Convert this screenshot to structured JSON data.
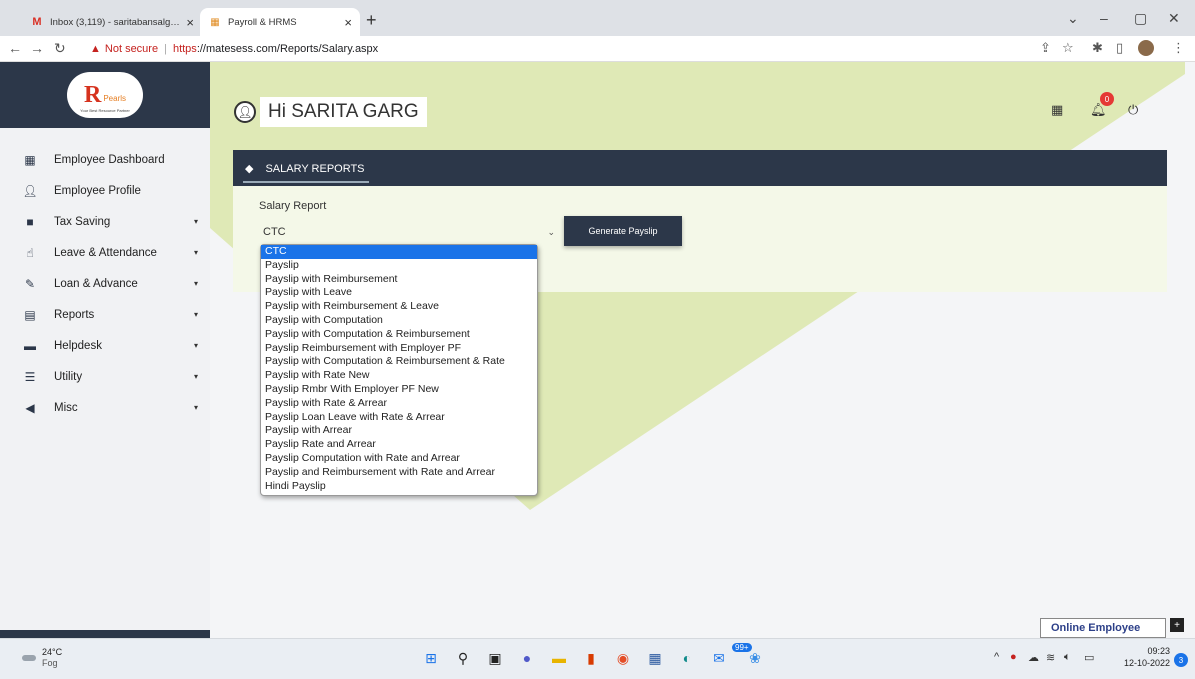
{
  "browser": {
    "tabs": [
      {
        "title": "Inbox (3,119) - saritabansalgarg. ",
        "favicon": "gmail-icon"
      },
      {
        "title": "Payroll & HRMS",
        "favicon": "hrms-icon"
      }
    ],
    "new_tab": "+",
    "not_secure": "Not secure",
    "url_scheme": "https",
    "url_rest": "://matesess.com/Reports/Salary.aspx"
  },
  "app": {
    "logo": {
      "letter": "R",
      "word": "Pearls",
      "tag": "Your Best Resource Partner"
    },
    "greeting": "Hi SARITA GARG",
    "notification_count": "0",
    "sidebar": [
      {
        "label": "Employee Dashboard",
        "icon": "dashboard-icon",
        "caret": ""
      },
      {
        "label": "Employee Profile",
        "icon": "user-icon",
        "caret": ""
      },
      {
        "label": "Tax Saving",
        "icon": "book-icon",
        "caret": "▾"
      },
      {
        "label": "Leave & Attendance",
        "icon": "thumbs-up-icon",
        "caret": "▾"
      },
      {
        "label": "Loan & Advance",
        "icon": "edit-icon",
        "caret": "▾"
      },
      {
        "label": "Reports",
        "icon": "report-icon",
        "caret": "▾"
      },
      {
        "label": "Helpdesk",
        "icon": "laptop-icon",
        "caret": "▾"
      },
      {
        "label": "Utility",
        "icon": "list-icon",
        "caret": "▾"
      },
      {
        "label": "Misc",
        "icon": "megaphone-icon",
        "caret": "▾"
      }
    ],
    "section_title": "SALARY REPORTS",
    "field_label": "Salary Report",
    "selected_value": "CTC",
    "generate_button": "Generate Payslip",
    "options": [
      "CTC",
      "Payslip",
      "Payslip with Reimbursement",
      "Payslip with Leave",
      "Payslip with Reimbursement & Leave",
      "Payslip with Computation",
      "Payslip with Computation & Reimbursement",
      "Payslip Reimbursement with Employer PF",
      "Payslip with Computation & Reimbursement & Rate",
      "Payslip with Rate New",
      "Payslip Rmbr With Employer PF New",
      "Payslip with Rate & Arrear",
      "Payslip Loan Leave with Rate & Arrear",
      "Payslip with Arrear",
      "Payslip Rate and Arrear",
      "Payslip Computation with Rate and Arrear",
      "Payslip and Reimbursement with Rate and Arrear",
      "Hindi Payslip"
    ],
    "online_employee": "Online Employee"
  },
  "taskbar": {
    "temp": "24°C",
    "condition": "Fog",
    "mail_badge": "99+",
    "time": "09:23",
    "date": "12-10-2022",
    "notif_count": "3"
  },
  "colors": {
    "navy": "#2c3749",
    "lime_bg": "#dfe9b6",
    "select_blue": "#1a73e8"
  }
}
